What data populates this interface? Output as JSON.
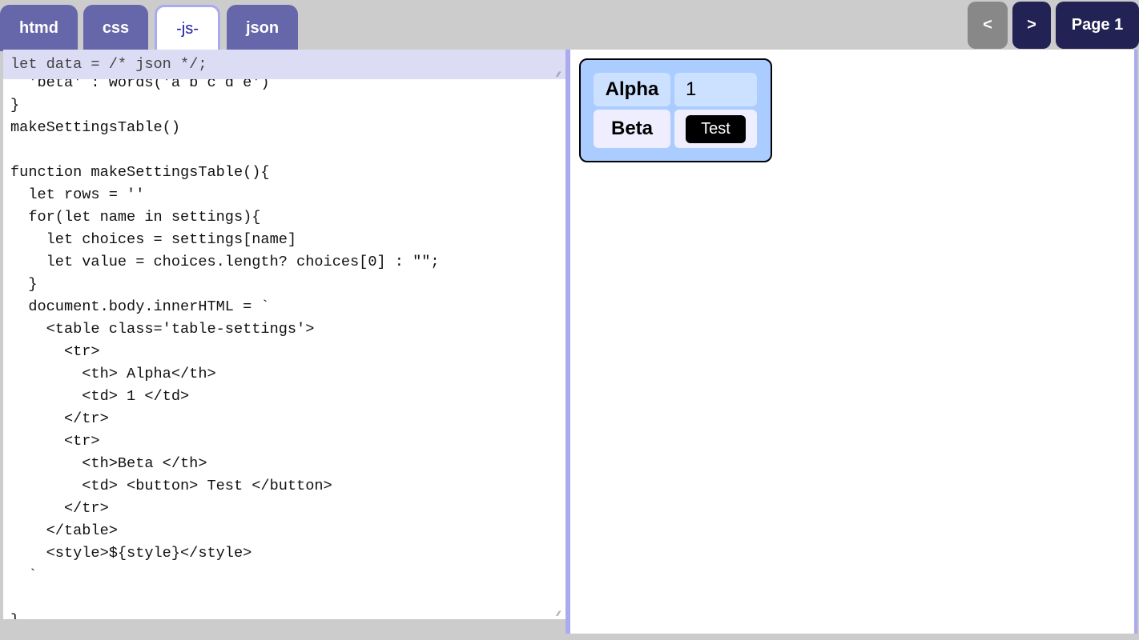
{
  "tabs": [
    {
      "label": "htmd"
    },
    {
      "label": "css"
    },
    {
      "label": "-js-",
      "active": true
    },
    {
      "label": "json"
    }
  ],
  "nav": {
    "prev": "<",
    "next": ">",
    "page": "Page 1"
  },
  "editor": {
    "data_line": "let data = /* json */;",
    "code": "  'beta' : words('a b c d e')\n}\nmakeSettingsTable()\n\nfunction makeSettingsTable(){\n  let rows = ''\n  for(let name in settings){\n    let choices = settings[name]\n    let value = choices.length? choices[0] : \"\";\n  }\n  document.body.innerHTML = `\n    <table class='table-settings'>\n      <tr>\n        <th> Alpha</th>\n        <td> 1 </td>\n      </tr>\n      <tr>\n        <th>Beta </th>\n        <td> <button> Test </button>\n      </tr>\n    </table>\n    <style>${style}</style>\n  `\n\n}"
  },
  "preview": {
    "rows": [
      {
        "header": "Alpha",
        "value": "1"
      },
      {
        "header": "Beta",
        "button": "Test"
      }
    ]
  },
  "colors": {
    "tab": "#6666aa",
    "nav_dark": "#222255",
    "nav_disabled": "#888888",
    "panel": "#aaccff",
    "accent_border": "#aaaaee"
  }
}
